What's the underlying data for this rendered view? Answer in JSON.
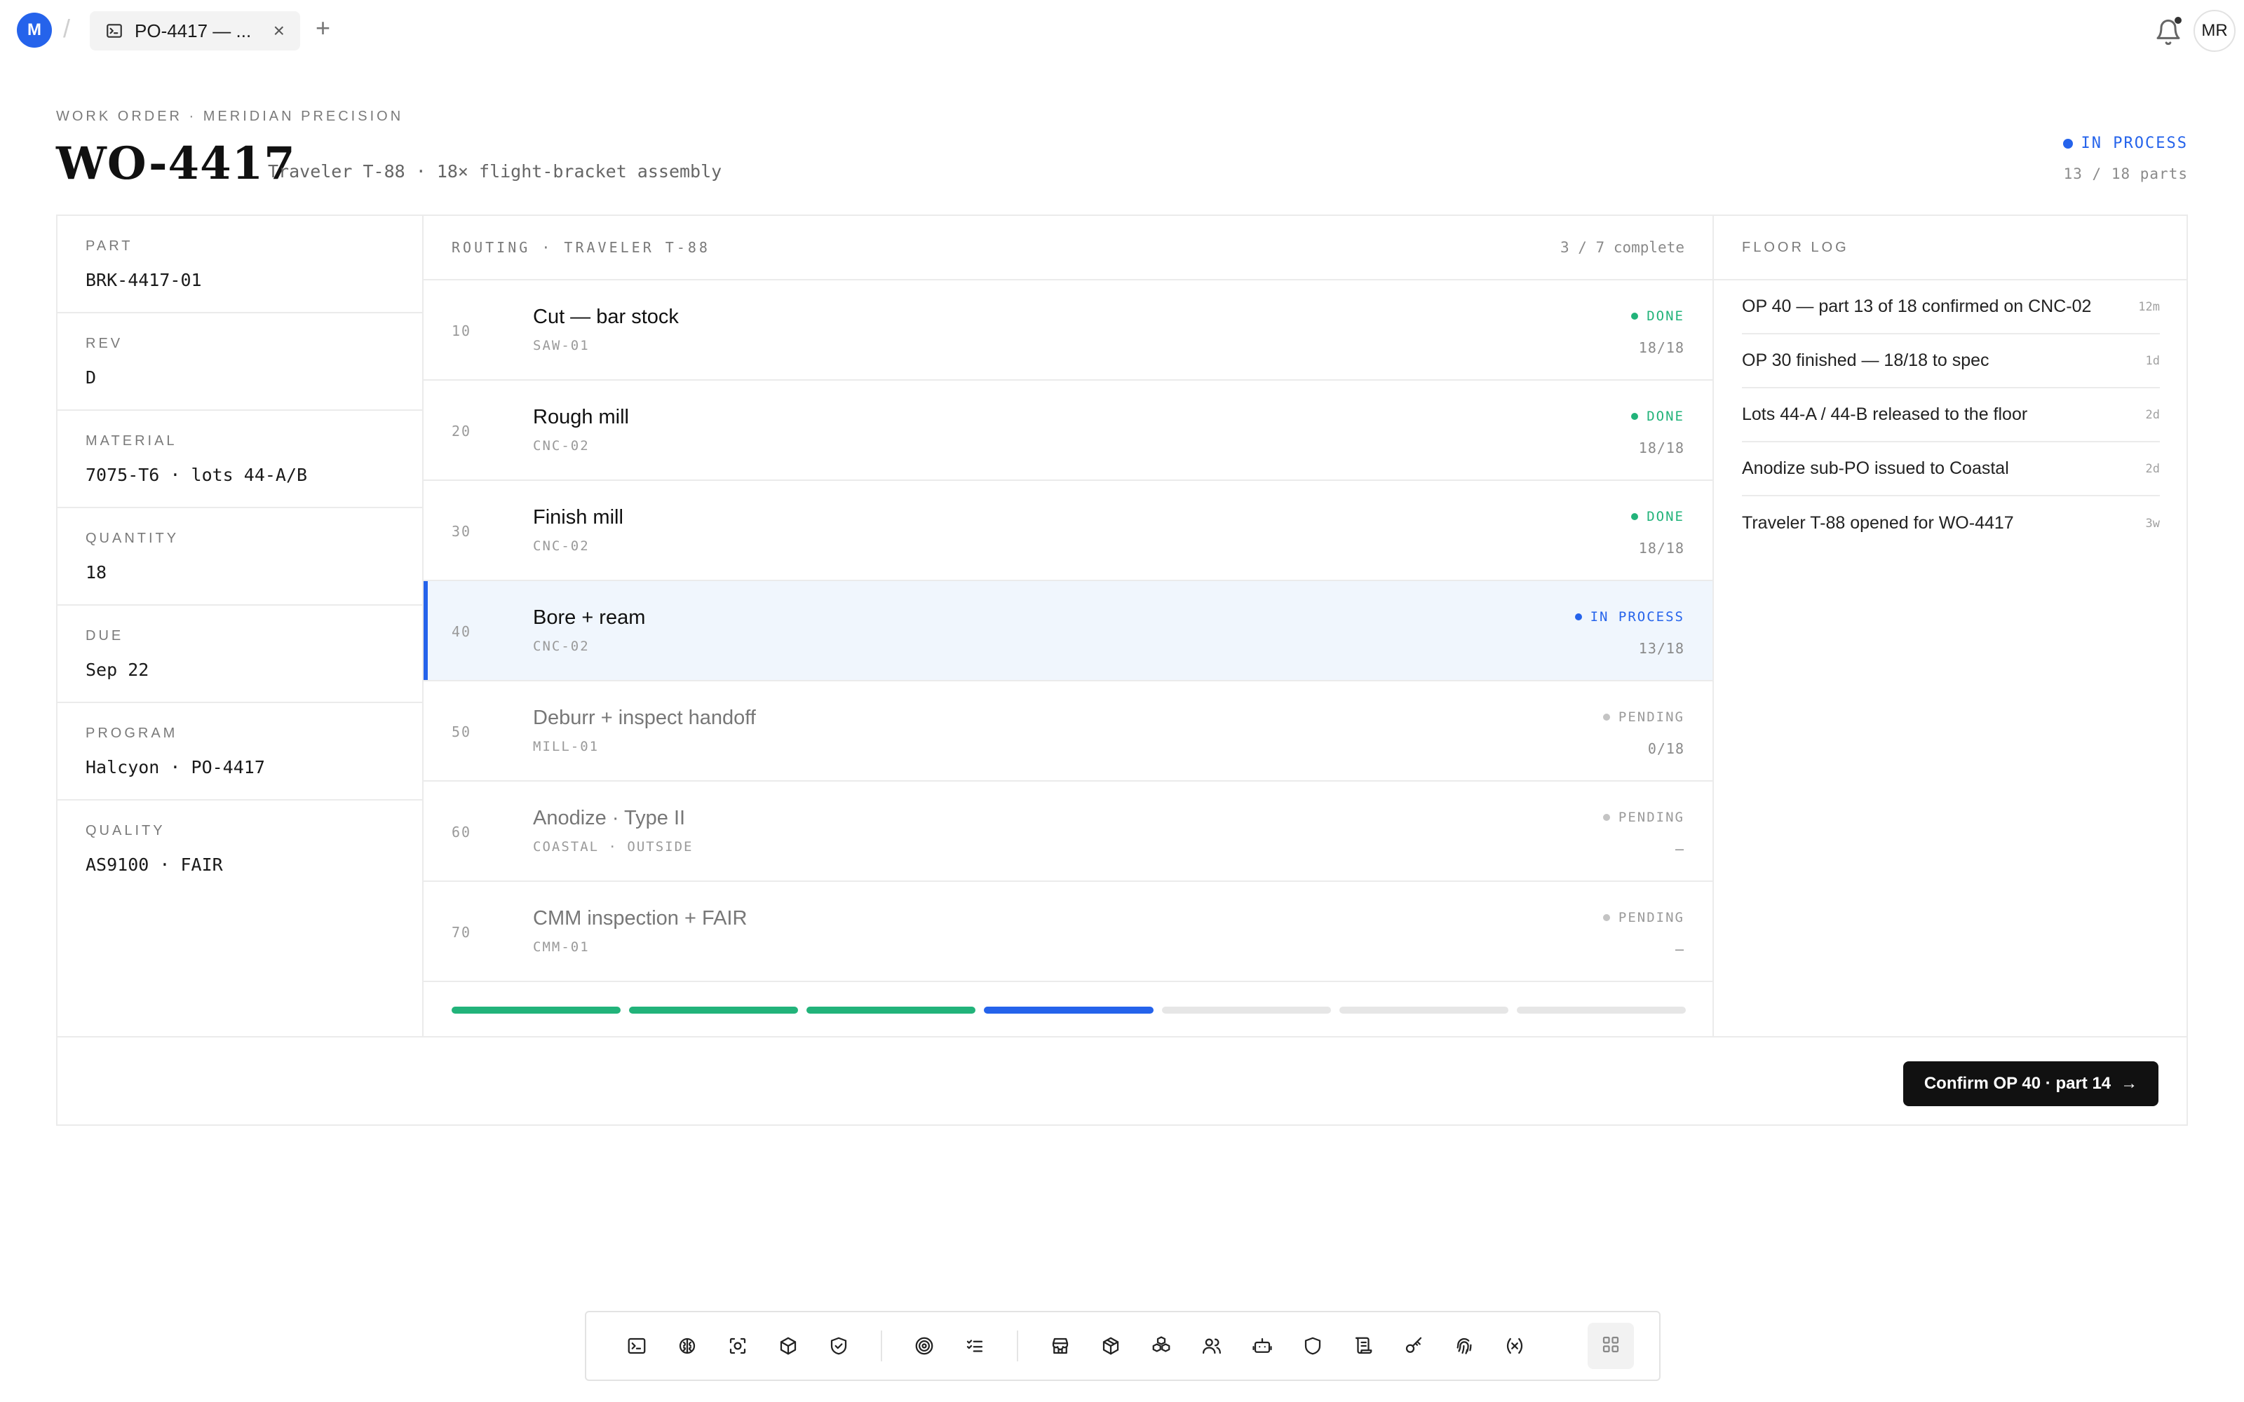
{
  "topbar": {
    "workspace_initial": "M",
    "tab_label": "PO-4417 — ...",
    "tab_close": "×",
    "new_tab": "+",
    "user_initials": "MR"
  },
  "header": {
    "eyebrow": "WORK ORDER · MERIDIAN PRECISION",
    "title": "WO-4417",
    "subtitle": "Traveler T-88 · 18× flight-bracket assembly",
    "status": "IN PROCESS",
    "status_color": "#2563eb",
    "parts": "13 / 18 parts"
  },
  "fields": [
    {
      "label": "PART",
      "value": "BRK-4417-01"
    },
    {
      "label": "REV",
      "value": "D"
    },
    {
      "label": "MATERIAL",
      "value": "7075-T6 · lots 44-A/B"
    },
    {
      "label": "QUANTITY",
      "value": "18"
    },
    {
      "label": "DUE",
      "value": "Sep 22"
    },
    {
      "label": "PROGRAM",
      "value": "Halcyon · PO-4417"
    },
    {
      "label": "QUALITY",
      "value": "AS9100 · FAIR"
    }
  ],
  "routing": {
    "title": "ROUTING · TRAVELER T-88",
    "count": "3 / 7 complete",
    "ops": [
      {
        "num": "10",
        "name": "Cut — bar stock",
        "machine": "SAW-01",
        "status": "DONE",
        "qty": "18/18",
        "state": "done"
      },
      {
        "num": "20",
        "name": "Rough mill",
        "machine": "CNC-02",
        "status": "DONE",
        "qty": "18/18",
        "state": "done"
      },
      {
        "num": "30",
        "name": "Finish mill",
        "machine": "CNC-02",
        "status": "DONE",
        "qty": "18/18",
        "state": "done"
      },
      {
        "num": "40",
        "name": "Bore + ream",
        "machine": "CNC-02",
        "status": "IN PROCESS",
        "qty": "13/18",
        "state": "active"
      },
      {
        "num": "50",
        "name": "Deburr + inspect handoff",
        "machine": "MILL-01",
        "status": "PENDING",
        "qty": "0/18",
        "state": "pending"
      },
      {
        "num": "60",
        "name": "Anodize · Type II",
        "machine": "COASTAL · OUTSIDE",
        "status": "PENDING",
        "qty": "—",
        "state": "pending"
      },
      {
        "num": "70",
        "name": "CMM inspection + FAIR",
        "machine": "CMM-01",
        "status": "PENDING",
        "qty": "—",
        "state": "pending"
      }
    ]
  },
  "colors": {
    "done": "#22b37a",
    "active": "#2563eb",
    "pending": "#c4c4c4",
    "pending_bar": "#e6e6e6"
  },
  "floor_log": {
    "title": "FLOOR LOG",
    "items": [
      {
        "text": "OP 40 — part 13 of 18 confirmed on CNC-02",
        "time": "12m"
      },
      {
        "text": "OP 30 finished — 18/18 to spec",
        "time": "1d"
      },
      {
        "text": "Lots 44-A / 44-B released to the floor",
        "time": "2d"
      },
      {
        "text": "Anodize sub-PO issued to Coastal",
        "time": "2d"
      },
      {
        "text": "Traveler T-88 opened for WO-4417",
        "time": "3w"
      }
    ]
  },
  "footer": {
    "confirm_label": "Confirm OP 40 · part 14",
    "confirm_arrow": "→"
  },
  "dock": {
    "icons": [
      "terminal-icon",
      "brain-icon",
      "scan-icon",
      "cube-icon",
      "shield-check-icon",
      "target-icon",
      "checklist-icon",
      "store-icon",
      "package-icon",
      "boxes-icon",
      "users-icon",
      "robot-icon",
      "shield-icon",
      "scroll-icon",
      "key-icon",
      "fingerprint-icon",
      "variable-icon"
    ],
    "grid_icon": "grid-icon"
  }
}
